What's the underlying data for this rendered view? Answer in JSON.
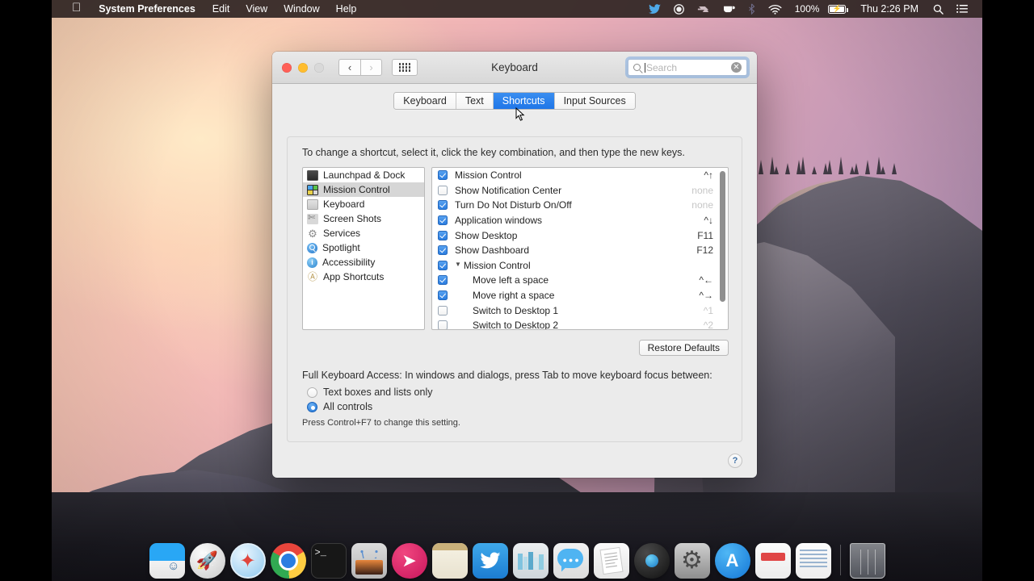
{
  "menubar": {
    "apple_icon": "apple-icon",
    "items": [
      {
        "label": "System Preferences",
        "bold": true
      },
      {
        "label": "Edit",
        "bold": false
      },
      {
        "label": "View",
        "bold": false
      },
      {
        "label": "Window",
        "bold": false
      },
      {
        "label": "Help",
        "bold": false
      }
    ],
    "status_icons": [
      "twitter-icon",
      "record-icon",
      "airmail-icon",
      "coffee-icon",
      "bluetooth-icon",
      "wifi-icon"
    ],
    "battery_percent": "100%",
    "battery_state": "charging",
    "clock": "Thu 2:26 PM",
    "spotlight_icon": "search-icon",
    "notification_icon": "notification-center-icon"
  },
  "window": {
    "title": "Keyboard",
    "traffic_lights": [
      "close-button",
      "minimize-button",
      "zoom-button"
    ],
    "back_label": "‹",
    "forward_label": "›",
    "grid_label": "show-all-icon",
    "search": {
      "placeholder": "Search",
      "value": "",
      "clear_label": "✕"
    },
    "help_label": "?"
  },
  "tabs": [
    {
      "label": "Keyboard",
      "selected": false
    },
    {
      "label": "Text",
      "selected": false
    },
    {
      "label": "Shortcuts",
      "selected": true
    },
    {
      "label": "Input Sources",
      "selected": false
    }
  ],
  "panel": {
    "instruction": "To change a shortcut, select it, click the key combination, and then type the new keys.",
    "restore_defaults_label": "Restore Defaults",
    "full_keyboard_access_label": "Full Keyboard Access: In windows and dialogs, press Tab to move keyboard focus between:",
    "radio_options": [
      {
        "label": "Text boxes and lists only",
        "selected": false
      },
      {
        "label": "All controls",
        "selected": true
      }
    ],
    "hint": "Press Control+F7 to change this setting."
  },
  "categories": [
    {
      "label": "Launchpad & Dock",
      "icon": "monitor-icon",
      "selected": false
    },
    {
      "label": "Mission Control",
      "icon": "mission-control-icon",
      "selected": true
    },
    {
      "label": "Keyboard",
      "icon": "keyboard-icon",
      "selected": false
    },
    {
      "label": "Screen Shots",
      "icon": "screenshot-icon",
      "selected": false
    },
    {
      "label": "Services",
      "icon": "gear-icon",
      "selected": false
    },
    {
      "label": "Spotlight",
      "icon": "spotlight-icon",
      "selected": false
    },
    {
      "label": "Accessibility",
      "icon": "accessibility-icon",
      "selected": false
    },
    {
      "label": "App Shortcuts",
      "icon": "app-shortcuts-icon",
      "selected": false
    }
  ],
  "shortcuts": [
    {
      "label": "Mission Control",
      "key": "^↑",
      "checked": true,
      "indent": false,
      "disclosure": false,
      "dim": false
    },
    {
      "label": "Show Notification Center",
      "key": "none",
      "checked": false,
      "indent": false,
      "disclosure": false,
      "dim": true
    },
    {
      "label": "Turn Do Not Disturb On/Off",
      "key": "none",
      "checked": true,
      "indent": false,
      "disclosure": false,
      "dim": true
    },
    {
      "label": "Application windows",
      "key": "^↓",
      "checked": true,
      "indent": false,
      "disclosure": false,
      "dim": false
    },
    {
      "label": "Show Desktop",
      "key": "F11",
      "checked": true,
      "indent": false,
      "disclosure": false,
      "dim": false
    },
    {
      "label": "Show Dashboard",
      "key": "F12",
      "checked": true,
      "indent": false,
      "disclosure": false,
      "dim": false
    },
    {
      "label": "Mission Control",
      "key": "",
      "checked": true,
      "indent": false,
      "disclosure": true,
      "dim": false
    },
    {
      "label": "Move left a space",
      "key": "^←",
      "checked": true,
      "indent": true,
      "disclosure": false,
      "dim": false
    },
    {
      "label": "Move right a space",
      "key": "^→",
      "checked": true,
      "indent": true,
      "disclosure": false,
      "dim": false
    },
    {
      "label": "Switch to Desktop 1",
      "key": "^1",
      "checked": false,
      "indent": true,
      "disclosure": false,
      "dim": true
    },
    {
      "label": "Switch to Desktop 2",
      "key": "^2",
      "checked": false,
      "indent": true,
      "disclosure": false,
      "dim": true
    }
  ],
  "dock": [
    {
      "name": "finder",
      "cls": "d-finder",
      "running": true
    },
    {
      "name": "launchpad",
      "cls": "d-launch",
      "running": false
    },
    {
      "name": "safari",
      "cls": "d-safari",
      "running": false
    },
    {
      "name": "google-chrome",
      "cls": "d-chrome",
      "running": true
    },
    {
      "name": "terminal",
      "cls": "d-term",
      "running": false
    },
    {
      "name": "robot-app",
      "cls": "d-robot",
      "running": false
    },
    {
      "name": "airmail",
      "cls": "d-pink",
      "running": false
    },
    {
      "name": "notes",
      "cls": "d-notes",
      "running": false
    },
    {
      "name": "twitter",
      "cls": "d-twitter",
      "running": true
    },
    {
      "name": "ibooks",
      "cls": "d-ibooks",
      "running": false
    },
    {
      "name": "messages",
      "cls": "d-msg",
      "running": true
    },
    {
      "name": "pages",
      "cls": "d-pages",
      "running": false
    },
    {
      "name": "quicktime",
      "cls": "d-qt",
      "running": true
    },
    {
      "name": "system-preferences",
      "cls": "d-sysprefs",
      "running": true
    },
    {
      "name": "app-store",
      "cls": "d-appstore",
      "running": false
    },
    {
      "name": "mail",
      "cls": "d-mail2",
      "running": false
    },
    {
      "name": "document-app",
      "cls": "d-doc",
      "running": false
    },
    {
      "name": "trash",
      "cls": "d-trash",
      "running": false
    }
  ],
  "colors": {
    "accent_blue": "#1f76e8",
    "menubar_bg": "#302624",
    "window_bg": "#ececec",
    "checkbox_on": "#2b7de0"
  }
}
